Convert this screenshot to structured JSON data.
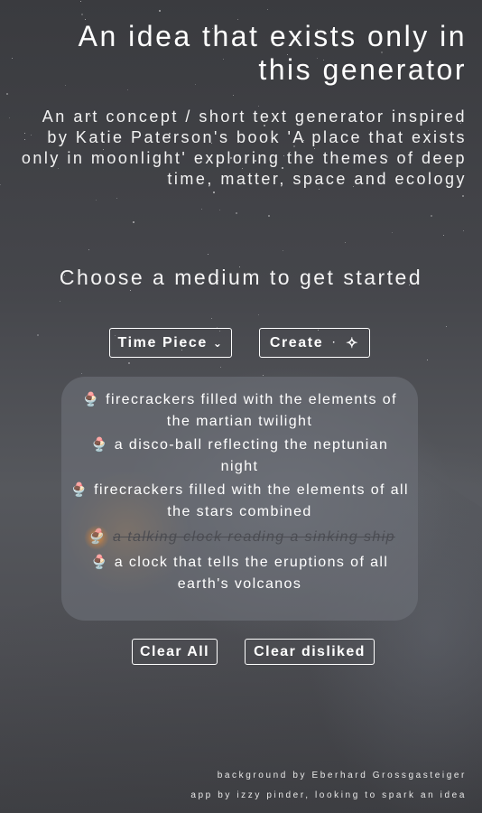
{
  "header": {
    "title": "An idea that exists only in this generator",
    "subtitle": "An art concept / short text generator inspired by Katie Paterson's book 'A place that exists only in moonlight' exploring the themes of deep time, matter, space and ecology"
  },
  "prompt": "Choose a medium to get started",
  "controls": {
    "medium_value": "Time Piece",
    "create_label": "Create",
    "create_icon": "sparkle-icon"
  },
  "ideas": [
    {
      "text": "firecrackers filled with the elements of the martian twilight",
      "disliked": false,
      "icon": "ice-cream-icon"
    },
    {
      "text": "a disco-ball reflecting the neptunian night",
      "disliked": false,
      "icon": "ice-cream-icon"
    },
    {
      "text": "firecrackers filled with the elements of all the stars combined",
      "disliked": false,
      "icon": "ice-cream-icon"
    },
    {
      "text": "a talking clock reading a sinking ship",
      "disliked": true,
      "icon": "ice-cream-icon"
    },
    {
      "text": "a clock that tells the eruptions of all earth's volcanos",
      "disliked": false,
      "icon": "ice-cream-icon"
    }
  ],
  "buttons": {
    "clear_all": "Clear All",
    "clear_disliked": "Clear disliked"
  },
  "footer": {
    "credit_background": "background by Eberhard Grossgasteiger",
    "credit_app": "app by izzy pinder, looking to spark an idea"
  }
}
